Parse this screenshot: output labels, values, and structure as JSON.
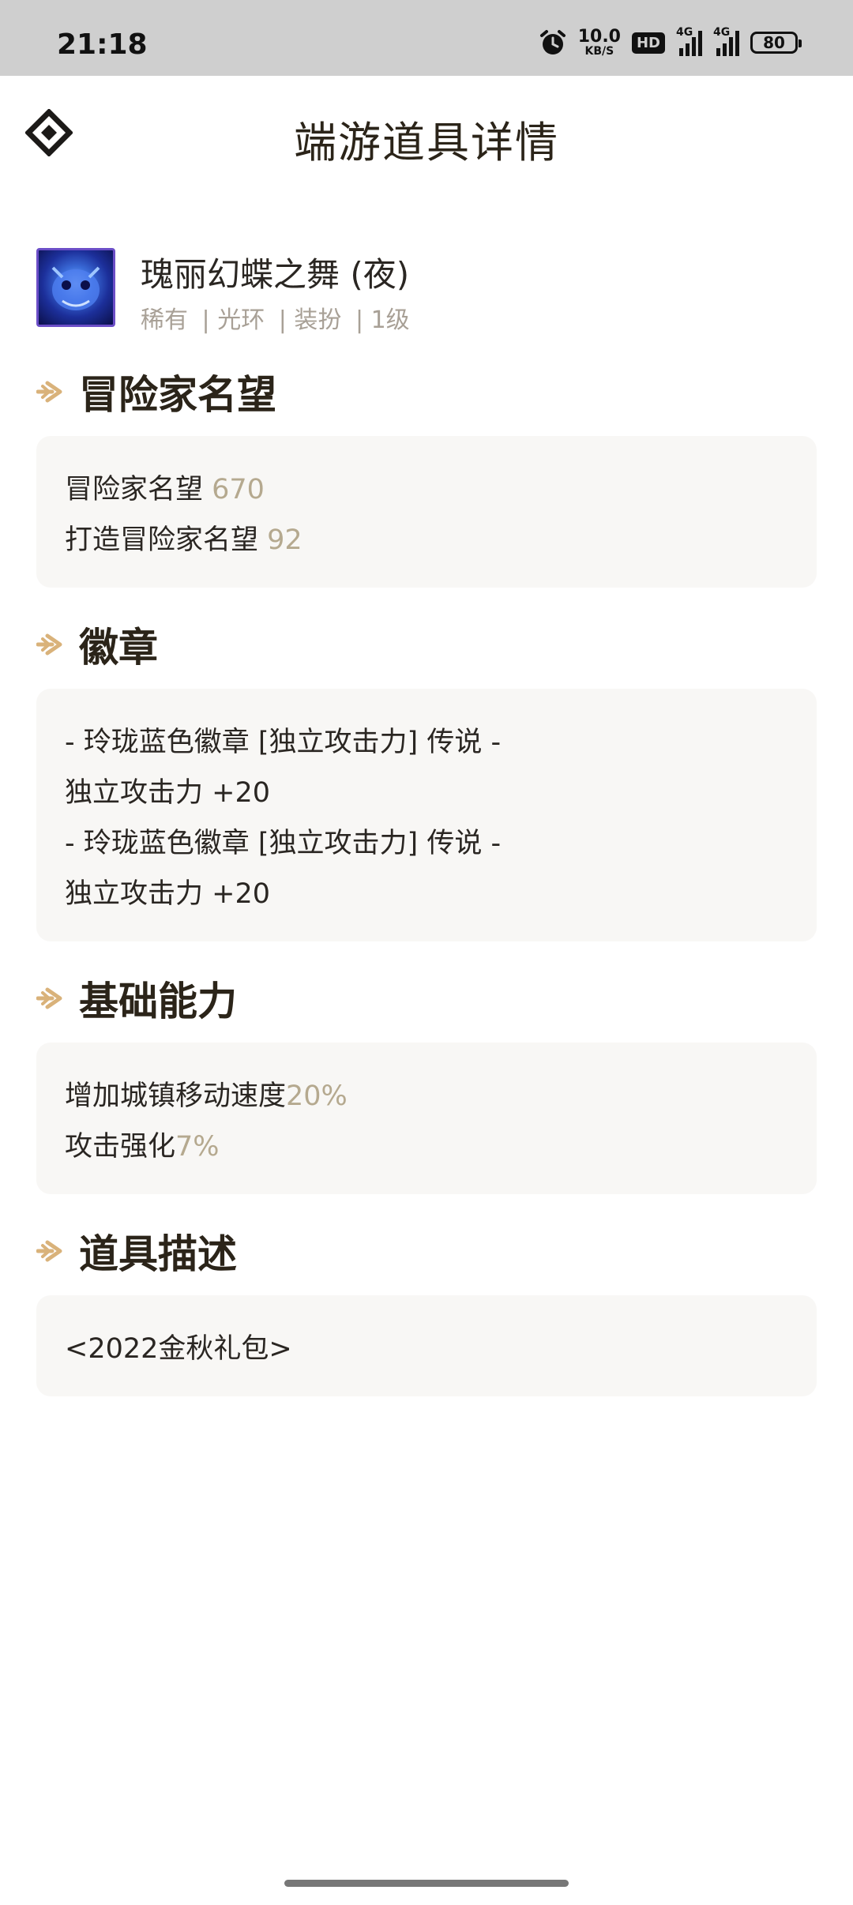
{
  "status_bar": {
    "time": "21:18",
    "net_speed_value": "10.0",
    "net_speed_unit": "KB/S",
    "hd_label": "HD",
    "sim1_tag": "4G",
    "sim2_tag": "4G",
    "battery": "80",
    "icons": [
      "alarm-icon",
      "hd-icon",
      "signal-icon",
      "signal-icon",
      "battery-icon"
    ]
  },
  "header": {
    "title": "端游道具详情",
    "back_icon": "back-diamond-icon"
  },
  "item": {
    "name": "瑰丽幻蝶之舞 (夜)",
    "tags": [
      "稀有",
      "| 光环",
      "| 装扮",
      "| 1级"
    ]
  },
  "sections": {
    "reputation": {
      "title": "冒险家名望",
      "lines": [
        {
          "label": "冒险家名望 ",
          "value": "670"
        },
        {
          "label": "打造冒险家名望 ",
          "value": "92"
        }
      ]
    },
    "emblem": {
      "title": "徽章",
      "lines": [
        "- 玲珑蓝色徽章 [独立攻击力] 传说 -",
        "独立攻击力 +20",
        "- 玲珑蓝色徽章 [独立攻击力] 传说 -",
        "独立攻击力 +20"
      ]
    },
    "basic": {
      "title": "基础能力",
      "lines": [
        {
          "label": "增加城镇移动速度",
          "value": "20%"
        },
        {
          "label": "攻击强化",
          "value": "7%"
        }
      ]
    },
    "description": {
      "title": "道具描述",
      "lines": [
        "<2022金秋礼包>"
      ]
    }
  },
  "colors": {
    "accent_arrow": "#d9b27a",
    "value_text": "#b5a98f",
    "card_bg": "#f8f7f5",
    "status_bar_bg": "#cfcfcf"
  }
}
